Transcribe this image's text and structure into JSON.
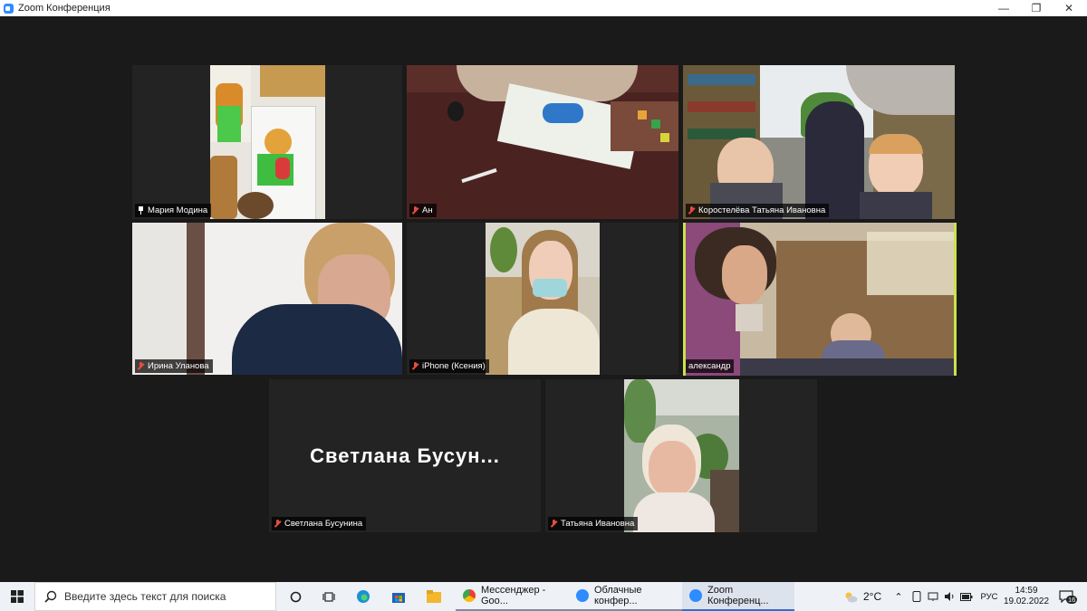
{
  "window": {
    "title": "Zoom Конференция",
    "controls": {
      "minimize": "—",
      "restore": "❐",
      "close": "✕"
    }
  },
  "participants": [
    {
      "name": "Мария Модина",
      "indicator": "pin-icon"
    },
    {
      "name": "Ан",
      "indicator": "mic-muted-icon"
    },
    {
      "name": "Коростелёва Татьяна Ивановна",
      "indicator": "mic-muted-icon"
    },
    {
      "name": "Ирина Уланова",
      "indicator": "mic-muted-icon"
    },
    {
      "name": "iPhone (Ксения)",
      "indicator": "mic-muted-icon"
    },
    {
      "name": "александр",
      "indicator": "none",
      "active_speaker": true
    },
    {
      "name": "Светлана Бусунина",
      "indicator": "mic-muted-icon",
      "video_off_label": "Светлана  Бусун..."
    },
    {
      "name": "Татьяна Ивановна",
      "indicator": "mic-muted-icon"
    }
  ],
  "taskbar": {
    "search_placeholder": "Введите здесь текст для поиска",
    "apps": [
      {
        "label": "Мессенджер - Goo...",
        "icon": "chrome-icon",
        "color": "#4285f4"
      },
      {
        "label": "Облачные конфер...",
        "icon": "zoom-icon",
        "color": "#2d8cff"
      },
      {
        "label": "Zoom Конференц...",
        "icon": "zoom-icon",
        "color": "#2d8cff"
      }
    ],
    "weather": "2°C",
    "language": "РУС",
    "time": "14:59",
    "date": "19.02.2022",
    "notifications": "16"
  },
  "colors": {
    "active_speaker_border": "#c9e34a",
    "muted_mic": "#e74c3c",
    "zoom_blue": "#2d8cff"
  }
}
